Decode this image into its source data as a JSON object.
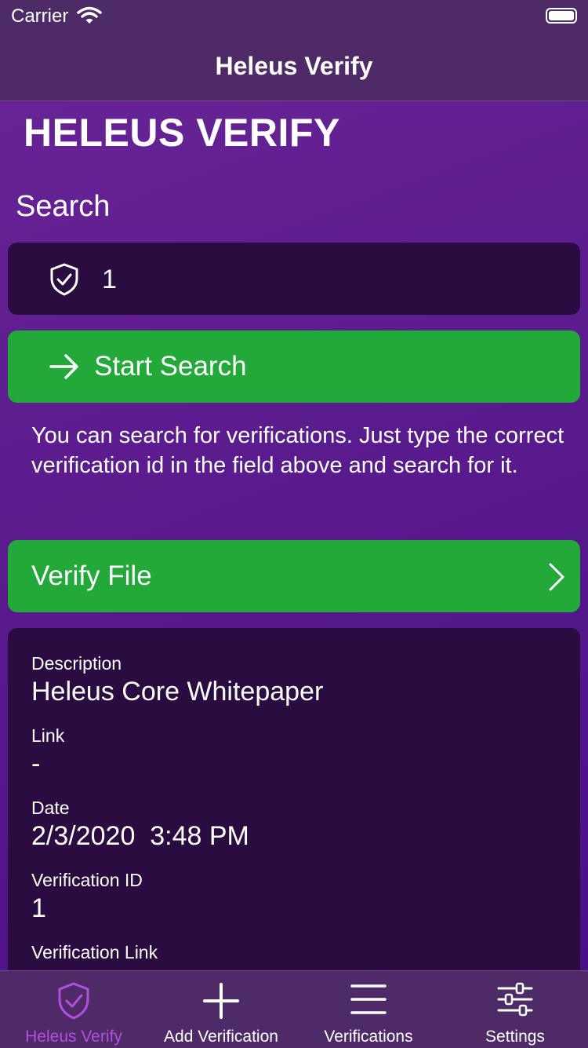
{
  "status_bar": {
    "carrier": "Carrier"
  },
  "nav": {
    "title": "Heleus Verify"
  },
  "main": {
    "app_title": "HELEUS VERIFY",
    "section_label": "Search",
    "search_value": "1",
    "start_search_label": "Start Search",
    "help_text": "You can search for verifications. Just type the correct verification id in the field above and search for it.",
    "verify_file_label": "Verify File"
  },
  "card": {
    "fields": [
      {
        "label": "Description",
        "value": "Heleus Core Whitepaper"
      },
      {
        "label": "Link",
        "value": "-"
      },
      {
        "label": "Date",
        "value": "2/3/2020  3:48 PM"
      },
      {
        "label": "Verification ID",
        "value": "1"
      },
      {
        "label": "Verification Link",
        "value": ""
      }
    ]
  },
  "tabs": [
    {
      "label": "Heleus Verify",
      "icon": "shield-check-icon",
      "active": true
    },
    {
      "label": "Add Verification",
      "icon": "plus-icon",
      "active": false
    },
    {
      "label": "Verifications",
      "icon": "list-icon",
      "active": false
    },
    {
      "label": "Settings",
      "icon": "sliders-icon",
      "active": false
    }
  ],
  "colors": {
    "accent_green": "#22a93a",
    "active_tab": "#b24fe0",
    "card_bg": "#2b0c40",
    "bar_bg": "#4e2a67"
  }
}
